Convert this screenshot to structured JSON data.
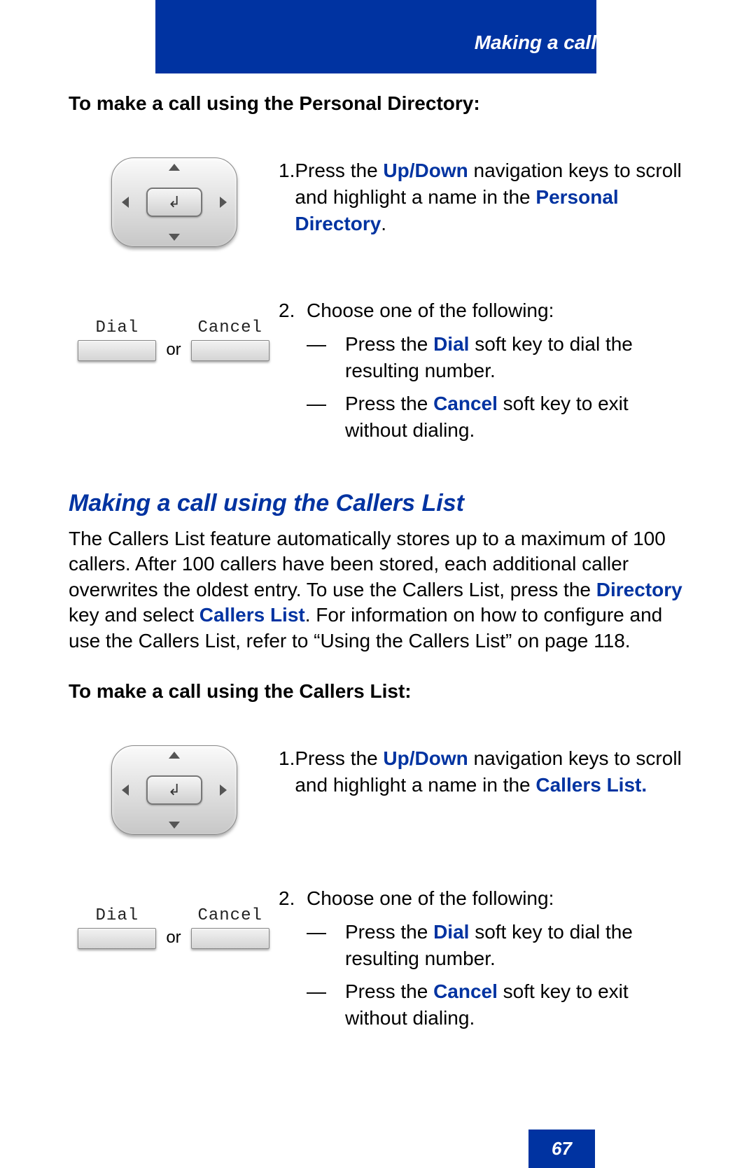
{
  "header": {
    "title": "Making a call"
  },
  "intro1": "To make a call using the Personal Directory:",
  "section1": {
    "step1": {
      "num": "1.",
      "t1": "Press the ",
      "link1": "Up/Down",
      "t2": " navigation keys to scroll and highlight a name in the ",
      "link2": "Personal Directory",
      "t3": "."
    },
    "step2": {
      "num": "2.",
      "lead": "Choose one of the following:",
      "a_pre": "Press the ",
      "a_link": "Dial",
      "a_post": " soft key to dial the resulting number.",
      "b_pre": "Press the ",
      "b_link": "Cancel",
      "b_post": " soft key to exit without dialing."
    }
  },
  "heading2": "Making a call using the Callers List",
  "para2": {
    "t1": "The Callers List feature automatically stores up to a maximum of 100 callers. After 100 callers have been stored, each additional caller overwrites the oldest entry. To use the Callers List, press the ",
    "link1": "Directory",
    "t2": " key and select ",
    "link2": "Callers List",
    "t3": ". For information on how to configure and use the Callers List, refer to “Using the Callers List” on page 118."
  },
  "intro2": "To make a call using the Callers List:",
  "section2": {
    "step1": {
      "num": "1.",
      "t1": "Press the ",
      "link1": "Up/Down",
      "t2": " navigation keys to scroll and highlight a name in the ",
      "link2": "Callers List.",
      "t3": ""
    },
    "step2": {
      "num": "2.",
      "lead": "Choose one of the following:",
      "a_pre": "Press the ",
      "a_link": "Dial",
      "a_post": " soft key to dial the resulting number.",
      "b_pre": "Press the ",
      "b_link": "Cancel",
      "b_post": " soft key to exit without dialing."
    }
  },
  "softkeys": {
    "dial": "Dial",
    "cancel": "Cancel",
    "or": "or"
  },
  "nav_enter": "↲",
  "page_number": "67"
}
